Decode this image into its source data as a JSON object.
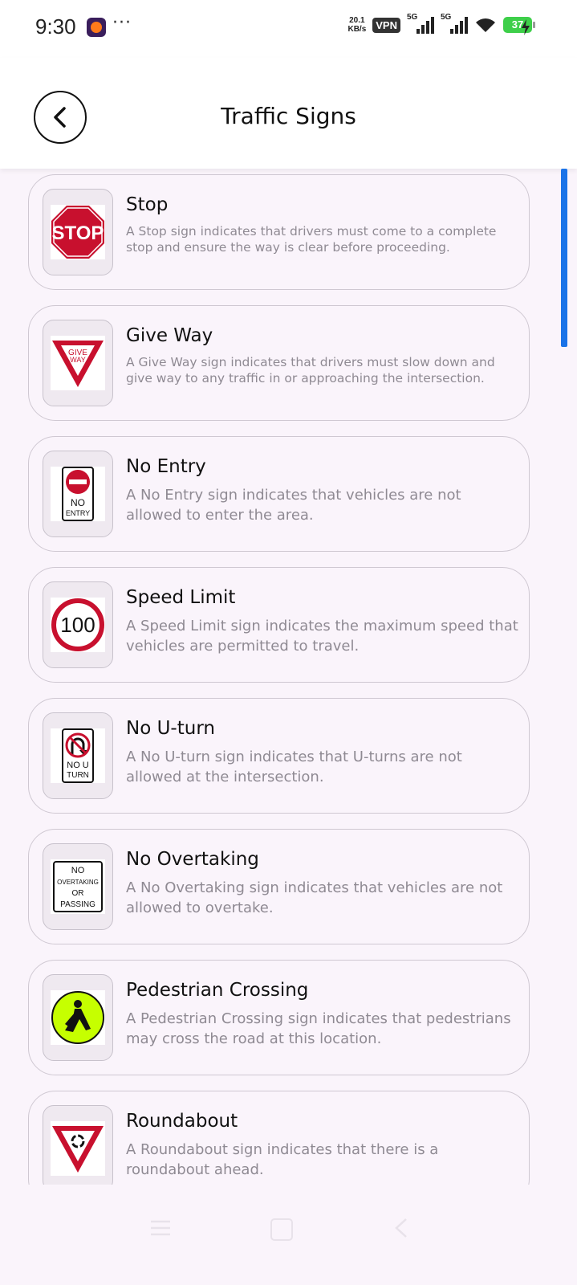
{
  "status_bar": {
    "time": "9:30",
    "more": "···",
    "net_speed_value": "20.1",
    "net_speed_unit": "KB/s",
    "vpn": "VPN",
    "sim1": "5G",
    "sim2": "5G",
    "battery": "37"
  },
  "header": {
    "title": "Traffic Signs",
    "back_icon": "chevron-left-icon"
  },
  "signs": [
    {
      "title": "Stop",
      "description": "A Stop sign indicates that drivers must come to a complete stop and ensure the way is clear before proceeding.",
      "icon": "stop-sign-icon",
      "sign_text": "STOP"
    },
    {
      "title": "Give Way",
      "description": "A Give Way sign indicates that drivers must slow down and give way to any traffic in or approaching the intersection.",
      "icon": "give-way-sign-icon",
      "sign_text_1": "GIVE",
      "sign_text_2": "WAY"
    },
    {
      "title": "No Entry",
      "description": "A No Entry sign indicates that vehicles are not allowed to enter the area.",
      "icon": "no-entry-sign-icon",
      "sign_text_1": "NO",
      "sign_text_2": "ENTRY"
    },
    {
      "title": "Speed Limit",
      "description": "A Speed Limit sign indicates the maximum speed that vehicles are permitted to travel.",
      "icon": "speed-limit-sign-icon",
      "sign_text": "100"
    },
    {
      "title": "No U-turn",
      "description": "A No U-turn sign indicates that U-turns are not allowed at the intersection.",
      "icon": "no-u-turn-sign-icon",
      "sign_text_1": "NO U",
      "sign_text_2": "TURN"
    },
    {
      "title": "No Overtaking",
      "description": "A No Overtaking sign indicates that vehicles are not allowed to overtake.",
      "icon": "no-overtaking-sign-icon",
      "sign_text_1": "NO",
      "sign_text_2": "OVERTAKING",
      "sign_text_3": "OR",
      "sign_text_4": "PASSING"
    },
    {
      "title": "Pedestrian Crossing",
      "description": "A Pedestrian Crossing sign indicates that pedestrians may cross the road at this location.",
      "icon": "pedestrian-crossing-sign-icon"
    },
    {
      "title": "Roundabout",
      "description": "A Roundabout sign indicates that there is a roundabout ahead.",
      "icon": "roundabout-sign-icon"
    }
  ],
  "colors": {
    "background": "#faf4fb",
    "card_border": "#cfc8d2",
    "sign_red": "#c8102e",
    "pedestrian_yellow": "#c6ff00",
    "scrollbar": "#1a73e8"
  }
}
